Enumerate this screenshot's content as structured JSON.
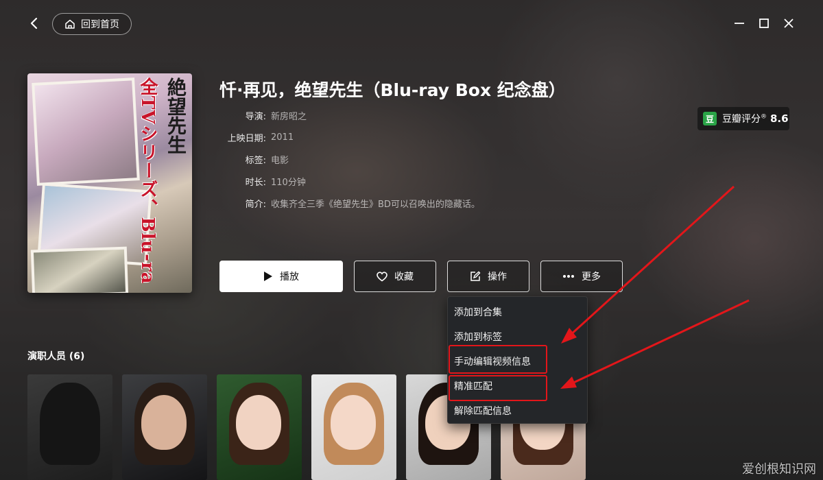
{
  "window": {
    "back_icon": "chevron-left-icon",
    "home_button_label": "回到首页",
    "home_icon": "home-icon",
    "controls": [
      "minimize-icon",
      "maximize-icon",
      "close-icon"
    ]
  },
  "movie": {
    "title": "忏·再见，绝望先生（Blu-ray Box 纪念盘）",
    "poster_text_red": "全TVシリーズ、Blu-ray BOX化!!",
    "poster_text_black": "絶望先生",
    "info": [
      {
        "label": "导演:",
        "value": "新房昭之"
      },
      {
        "label": "上映日期:",
        "value": "2011"
      },
      {
        "label": "标签:",
        "value": "电影"
      },
      {
        "label": "时长:",
        "value": "110分钟"
      },
      {
        "label": "简介:",
        "value": "收集齐全三季《绝望先生》BD可以召唤出的隐藏话。"
      }
    ]
  },
  "rating": {
    "logo_text": "豆",
    "label": "豆瓣评分",
    "reg_mark": "®",
    "score": "8.6",
    "brand_color": "#2aa447"
  },
  "actions": {
    "play_label": "播放",
    "favorite_label": "收藏",
    "operate_label": "操作",
    "more_label": "更多"
  },
  "dropdown": {
    "items": [
      "添加到合集",
      "添加到标签",
      "手动编辑视频信息",
      "精准匹配",
      "解除匹配信息"
    ]
  },
  "annotation_color": "#e3161a",
  "cast": {
    "title": "演职人员 (6)"
  },
  "watermark": "爱创根知识网"
}
